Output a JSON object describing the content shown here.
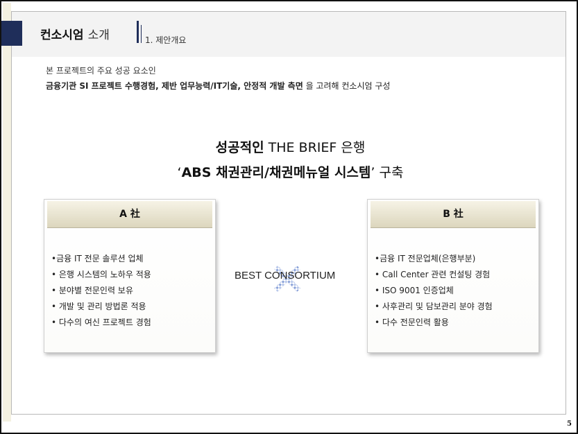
{
  "header": {
    "title_bold": "컨소시엄",
    "title_rest": "소개",
    "section": "1. 제안개요"
  },
  "intro": {
    "line1": "본 프로젝트의 주요 성공 요소인",
    "line2_bold": "금융기관 SI 프로젝트 수행경험, 제반 업무능력/IT기술, 안정적 개발 측면",
    "line2_rest": " 을 고려해 컨소시엄 구성"
  },
  "headline": {
    "l1_bold": "성공적인",
    "l1_rest": " THE BRIEF 은행",
    "l2_pre": "‘",
    "l2_bold": "ABS 채권관리/채권메뉴얼 시스템",
    "l2_rest": "’ 구축"
  },
  "company_a": {
    "title": "A 社",
    "items": [
      "•금융 IT 전문  솔루션 업체",
      "• 은행 시스템의 노하우 적용",
      "• 분야별 전문인력 보유",
      "• 개발 및 관리 방법론 적용",
      "• 다수의 여신 프로젝트 경험"
    ]
  },
  "company_b": {
    "title": "B 社",
    "items": [
      "•금융 IT 전문업체(은행부분)",
      "• Call Center 관련 컨설팅 경험",
      "• ISO 9001 인증업체",
      "• 사후관리 및 담보관리 분야 경험",
      "• 다수 전문인력 활용"
    ]
  },
  "center_label": "BEST CONSORTIUM",
  "page_number": "5",
  "colors": {
    "navy": "#1f2e5a",
    "card_header": "#dcd6bd",
    "cross": "#5f7fc4"
  }
}
